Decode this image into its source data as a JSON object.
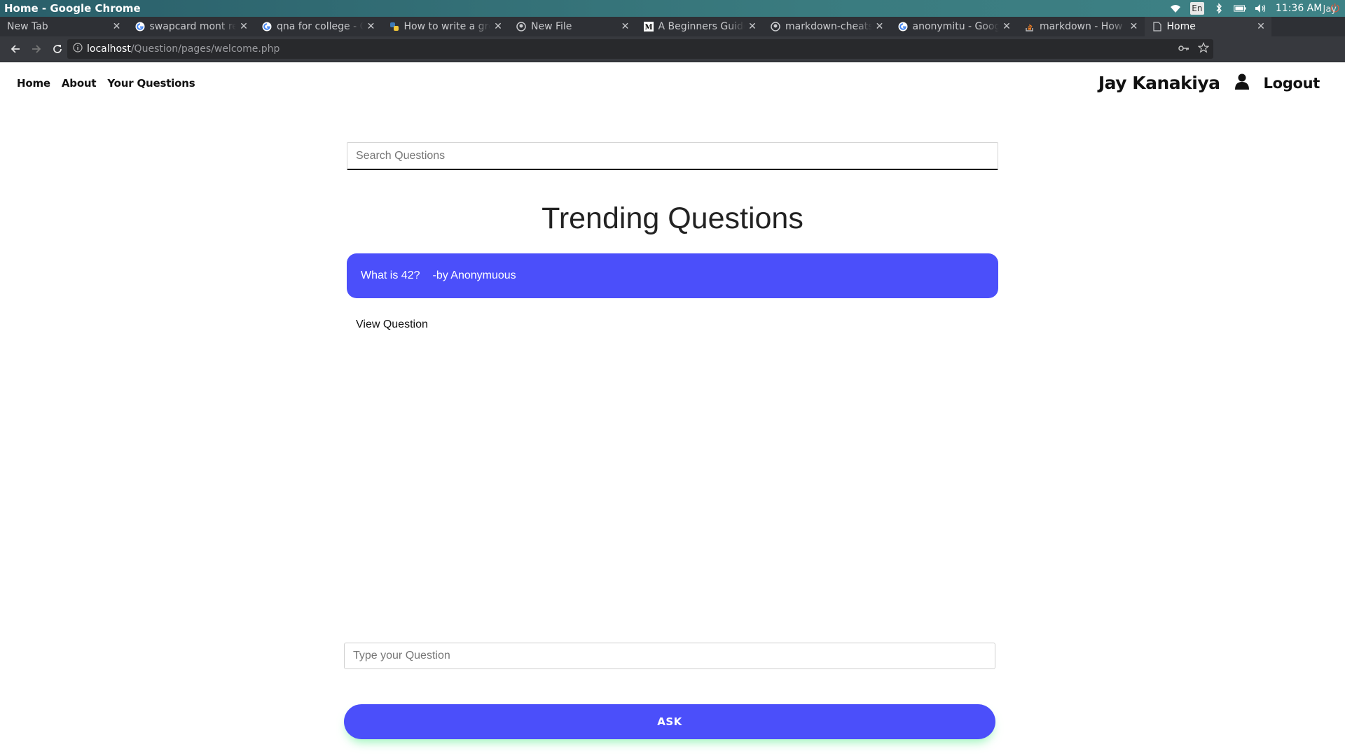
{
  "os": {
    "window_title": "Home - Google Chrome",
    "keyboard_layout": "En",
    "clock": "11:36 AM"
  },
  "tabs": [
    {
      "title": "New Tab",
      "icon": "none",
      "active": false
    },
    {
      "title": "swapcard mont re",
      "icon": "google-icon",
      "active": false
    },
    {
      "title": "qna for college - G",
      "icon": "google-icon",
      "active": false
    },
    {
      "title": "How to write a gre",
      "icon": "python-icon",
      "active": false
    },
    {
      "title": "New File",
      "icon": "github-icon",
      "active": false
    },
    {
      "title": "A Beginners Guide",
      "icon": "medium-icon",
      "active": false
    },
    {
      "title": "markdown-cheats",
      "icon": "github-icon",
      "active": false
    },
    {
      "title": "anonymitu - Goog",
      "icon": "google-icon",
      "active": false
    },
    {
      "title": "markdown - How",
      "icon": "stackoverflow-icon",
      "active": false
    },
    {
      "title": "Home",
      "icon": "page-icon",
      "active": true
    }
  ],
  "browser": {
    "profile_name": "Jay",
    "url_host": "localhost",
    "url_path": "/Question/pages/welcome.php"
  },
  "site": {
    "nav": {
      "home": "Home",
      "about": "About",
      "your_questions": "Your Questions"
    },
    "user_name": "Jay Kanakiya",
    "logout": "Logout",
    "search_placeholder": "Search Questions",
    "section_title": "Trending Questions",
    "questions": [
      {
        "text": "What is 42?",
        "author": "-by Anonymuous",
        "link": "View Question"
      }
    ],
    "ask_placeholder": "Type your Question",
    "ask_button": "ASK",
    "accent_color": "#4b4ffa"
  }
}
